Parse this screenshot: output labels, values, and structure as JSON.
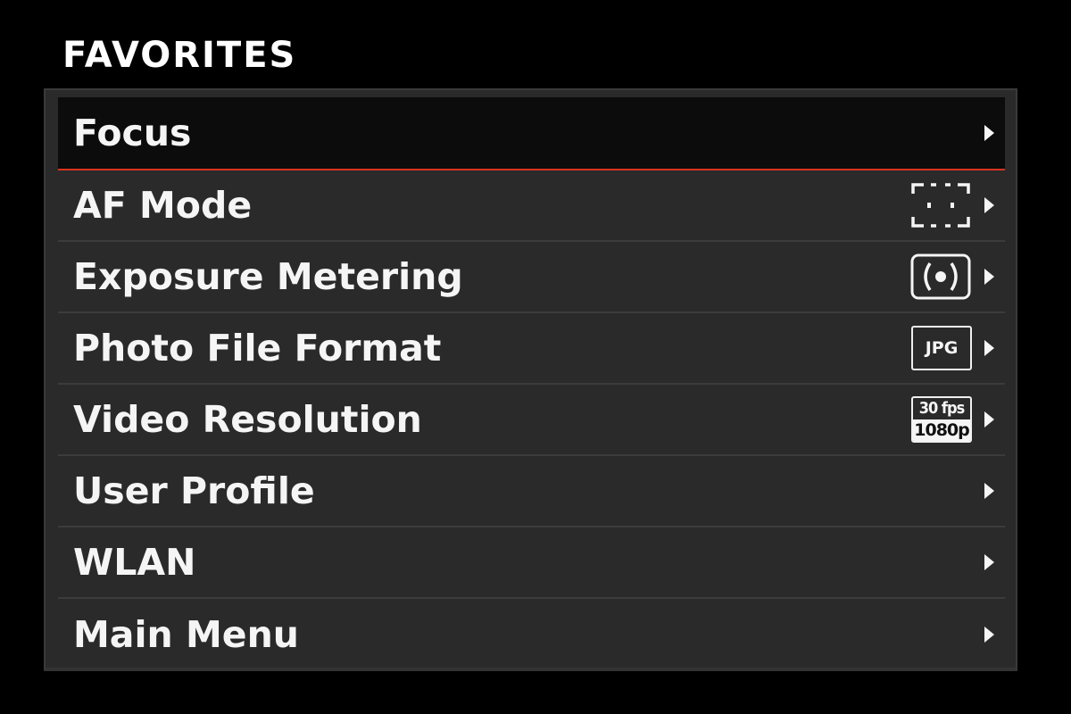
{
  "screen": {
    "title": "FAVORITES"
  },
  "menu": {
    "items": [
      {
        "label": "Focus",
        "value_icon": "",
        "selected": true
      },
      {
        "label": "AF Mode",
        "value_icon": "af-field-brackets-icon"
      },
      {
        "label": "Exposure Metering",
        "value_icon": "spot-metering-icon"
      },
      {
        "label": "Photo File Format",
        "value_text": "JPG",
        "value_icon": "jpg-format-badge"
      },
      {
        "label": "Video Resolution",
        "value_top": "30 fps",
        "value_bottom": "1080p",
        "value_icon": "video-resolution-badge"
      },
      {
        "label": "User Profile"
      },
      {
        "label": "WLAN"
      },
      {
        "label": "Main Menu"
      }
    ]
  },
  "colors": {
    "background": "#000000",
    "panel": "#2a2a2a",
    "selected_row": "#0c0c0c",
    "selection_accent": "#d8331f",
    "text": "#f5f5f5"
  }
}
